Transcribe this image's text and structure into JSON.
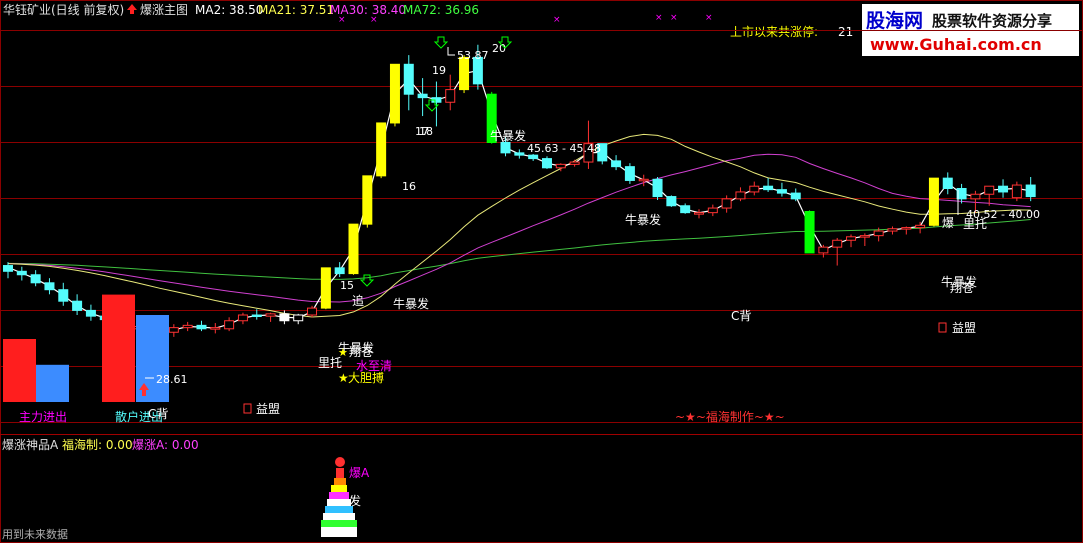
{
  "colors": {
    "bg": "#000000",
    "grid": "#8b0000",
    "up": "#ff3232",
    "down": "#54fcfc",
    "yellow": "#ffff00",
    "green": "#00ff00",
    "white": "#ffffff",
    "magenta": "#ff00ff",
    "ma_yellow": "#e8e87a",
    "ma_magenta": "#d040d0",
    "ma_green": "#40c040"
  },
  "header": {
    "title": "华钰矿业(日线 前复权)",
    "indicator": "爆涨主图",
    "ma2": "MA2: 38.50",
    "ma21": "MA21: 37.51",
    "ma30": "MA30: 38.40",
    "ma72": "MA72: 36.96",
    "limit_up_label": "上市以来共涨停:",
    "limit_up_value": "21"
  },
  "watermark": {
    "logo": "股海网",
    "slogan": "股票软件资源分享",
    "url": "www.Guhai.com.cn"
  },
  "lower_panel": {
    "title": "爆涨神品A",
    "field1": "福海制: 0.00",
    "field2": "爆涨A: 0.00",
    "footer": "用到未来数据",
    "tower_labels": [
      "爆A",
      "发"
    ]
  },
  "chart_data": {
    "type": "candlestick",
    "candles": [
      [
        38.3,
        38.6,
        37.2,
        37.8
      ],
      [
        37.8,
        38.2,
        37.0,
        37.5
      ],
      [
        37.5,
        37.9,
        36.5,
        36.8
      ],
      [
        36.8,
        37.2,
        35.8,
        36.2
      ],
      [
        36.2,
        36.8,
        34.8,
        35.2
      ],
      [
        35.2,
        35.8,
        34.0,
        34.4
      ],
      [
        34.4,
        34.9,
        33.5,
        33.9
      ],
      [
        33.9,
        34.4,
        33.2,
        33.6
      ],
      [
        33.6,
        34.0,
        32.4,
        32.8
      ],
      [
        32.8,
        33.5,
        32.2,
        33.0
      ],
      [
        33.0,
        33.4,
        32.3,
        32.6
      ],
      [
        32.6,
        33.2,
        32.0,
        32.5
      ],
      [
        32.5,
        33.2,
        32.1,
        32.9
      ],
      [
        32.9,
        33.4,
        32.6,
        33.1
      ],
      [
        33.1,
        33.5,
        32.6,
        32.8
      ],
      [
        32.8,
        33.3,
        32.4,
        32.9
      ],
      [
        32.8,
        33.8,
        32.6,
        33.5
      ],
      [
        33.5,
        34.2,
        33.2,
        34.0
      ],
      [
        34.0,
        34.5,
        33.6,
        33.9
      ],
      [
        33.9,
        34.2,
        33.4,
        34.1
      ],
      [
        34.1,
        34.4,
        33.2,
        33.5
      ],
      [
        33.5,
        34.1,
        33.2,
        34.0
      ],
      [
        34.0,
        34.8,
        33.8,
        34.6
      ],
      [
        34.6,
        38.1,
        34.5,
        38.1
      ],
      [
        38.1,
        38.6,
        37.3,
        37.6
      ],
      [
        37.6,
        41.9,
        37.5,
        41.9
      ],
      [
        41.9,
        46.1,
        41.6,
        46.1
      ],
      [
        46.1,
        50.7,
        45.9,
        50.7
      ],
      [
        50.7,
        55.8,
        50.4,
        55.8
      ],
      [
        55.8,
        56.6,
        51.8,
        53.2
      ],
      [
        53.2,
        54.6,
        51.3,
        52.9
      ],
      [
        52.9,
        54.3,
        50.4,
        52.5
      ],
      [
        52.5,
        54.9,
        51.8,
        53.6
      ],
      [
        53.6,
        56.6,
        53.3,
        56.4
      ],
      [
        56.4,
        57.5,
        53.6,
        54.1
      ],
      [
        53.2,
        53.4,
        48.9,
        49.0
      ],
      [
        49.0,
        49.5,
        47.8,
        48.1
      ],
      [
        48.1,
        48.4,
        47.6,
        47.9
      ],
      [
        47.9,
        48.0,
        47.4,
        47.6
      ],
      [
        47.6,
        47.8,
        46.7,
        46.8
      ],
      [
        46.8,
        47.2,
        46.5,
        47.1
      ],
      [
        47.1,
        47.5,
        46.9,
        47.3
      ],
      [
        47.3,
        50.9,
        46.7,
        48.9
      ],
      [
        48.9,
        48.9,
        47.1,
        47.4
      ],
      [
        47.4,
        47.9,
        46.6,
        46.9
      ],
      [
        46.9,
        47.2,
        45.4,
        45.7
      ],
      [
        45.7,
        46.2,
        45.2,
        45.8
      ],
      [
        45.8,
        46.0,
        44.0,
        44.3
      ],
      [
        44.3,
        44.4,
        43.4,
        43.5
      ],
      [
        43.5,
        43.7,
        42.8,
        42.9
      ],
      [
        42.9,
        43.2,
        42.4,
        42.9
      ],
      [
        42.9,
        43.6,
        42.6,
        43.3
      ],
      [
        43.3,
        44.4,
        42.9,
        44.1
      ],
      [
        44.1,
        45.1,
        43.9,
        44.7
      ],
      [
        44.7,
        45.6,
        44.4,
        45.2
      ],
      [
        45.2,
        45.9,
        44.7,
        44.9
      ],
      [
        44.9,
        45.5,
        44.3,
        44.6
      ],
      [
        44.6,
        45.0,
        43.9,
        44.1
      ],
      [
        43.0,
        43.1,
        39.4,
        39.4
      ],
      [
        39.4,
        40.1,
        39.0,
        39.9
      ],
      [
        39.9,
        40.7,
        38.3,
        40.5
      ],
      [
        40.5,
        41.0,
        39.9,
        40.8
      ],
      [
        40.8,
        41.1,
        40.0,
        40.9
      ],
      [
        40.9,
        41.6,
        40.4,
        41.3
      ],
      [
        41.3,
        41.7,
        41.0,
        41.5
      ],
      [
        41.5,
        41.7,
        41.0,
        41.6
      ],
      [
        41.6,
        42.1,
        41.1,
        41.8
      ],
      [
        41.8,
        45.9,
        41.7,
        45.9
      ],
      [
        45.9,
        46.4,
        44.5,
        45.0
      ],
      [
        45.0,
        45.4,
        43.7,
        44.1
      ],
      [
        44.1,
        44.8,
        42.9,
        44.5
      ],
      [
        44.5,
        45.2,
        43.5,
        45.2
      ],
      [
        45.2,
        45.8,
        44.2,
        44.7
      ],
      [
        44.2,
        45.6,
        43.9,
        45.3
      ],
      [
        45.3,
        46.0,
        43.9,
        44.3
      ]
    ],
    "ylim": [
      24,
      60
    ],
    "axis_value_labels": [
      "28.61",
      "45.63 - 45.48",
      "53.87",
      "40.52 - 40.00"
    ],
    "signal_labels": [
      "牛暴发",
      "牛暴发",
      "牛暴发",
      "牛暴发",
      "牛暴发",
      "翔苍",
      "翔苍",
      "里托",
      "里托",
      "追",
      "水至清",
      "大胆搏",
      "C背",
      "C背",
      "益盟",
      "益盟",
      "爆"
    ],
    "daily_limit_counts": [
      "15",
      "16",
      "17",
      "18",
      "19",
      "20"
    ],
    "credit": "~★~福海制作~★~",
    "left_bars": [
      {
        "name": "主力进出",
        "values": [
          10.5,
          6.2
        ],
        "colors": [
          "#ff1e1e",
          "#3c8cff"
        ]
      },
      {
        "name": "散户进出",
        "values": [
          17.9,
          14.5
        ],
        "colors": [
          "#ff1e1e",
          "#3c8cff"
        ]
      }
    ]
  }
}
